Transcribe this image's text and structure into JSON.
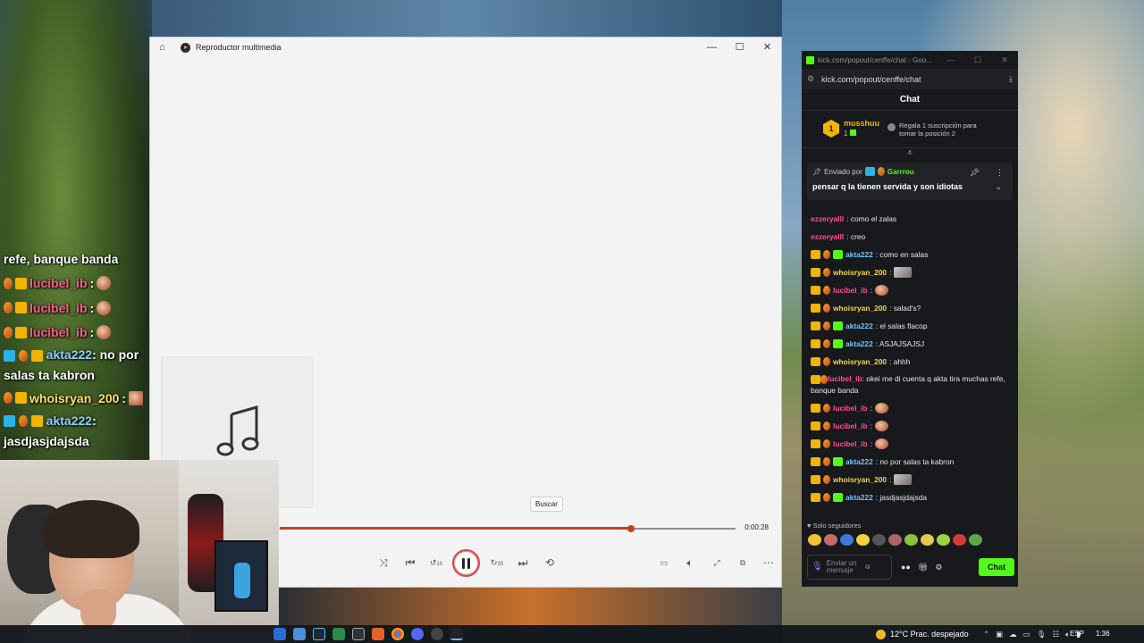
{
  "player": {
    "title": "Reproductor multimedia",
    "home_icon": "home-icon",
    "tooltip": "Buscar",
    "elapsed": "0:00:28",
    "progress_fraction": 0.77,
    "controls": [
      "shuffle-icon",
      "previous-icon",
      "rewind-10-icon",
      "pause-icon",
      "forward-30-icon",
      "next-icon",
      "repeat-icon"
    ],
    "rewind_label": "10",
    "forward_label": "30"
  },
  "overlay_chat": {
    "lines": [
      {
        "text": "refe, banque banda"
      },
      {
        "name": "lucibel_ib",
        "sep": ":"
      },
      {
        "name": "lucibel_ib",
        "sep": ":"
      },
      {
        "name": "lucibel_ib",
        "sep": ":"
      },
      {
        "name": "akta222",
        "msg": ": no por salas ta kabron"
      },
      {
        "name": "whoisryan_200",
        "sep": ":"
      },
      {
        "name": "akta222",
        "msg": ": jasdjasjdajsda"
      }
    ]
  },
  "kick": {
    "window_title": "kick.com/popout/cenffe/chat - Goo...",
    "url": "kick.com/popout/cenffe/chat",
    "header": "Chat",
    "leader": {
      "rank": "1",
      "name": "musshuu",
      "count": "1",
      "gift_text": "Regala 1 suscripción para tomar la posición 2"
    },
    "pinned": {
      "by_label": "Enviado por",
      "by_name": "Garrrou",
      "text": "pensar q la tienen servida y son idiotas"
    },
    "messages": [
      {
        "name": "ezzeryalll",
        "text": ": como el zalas",
        "color": "pink",
        "badges": false
      },
      {
        "name": "ezzeryalll",
        "text": ": creo",
        "color": "pink",
        "badges": false
      },
      {
        "name": "akta222",
        "text": ": como en salas",
        "color": "blue",
        "badges": true,
        "sub": true
      },
      {
        "name": "whoisryan_200",
        "text": ":",
        "color": "gold",
        "badges": true,
        "emote": true
      },
      {
        "name": "lucibel_ib",
        "text": ":",
        "color": "pink",
        "badges": true,
        "emote": true
      },
      {
        "name": "whoisryan_200",
        "text": ": salad's?",
        "color": "gold",
        "badges": true
      },
      {
        "name": "akta222",
        "text": ": el salas flacop",
        "color": "blue",
        "badges": true,
        "sub": true
      },
      {
        "name": "akta222",
        "text": ": ASJAJSAJSJ",
        "color": "blue",
        "badges": true,
        "sub": true
      },
      {
        "name": "whoisryan_200",
        "text": ": ahhh",
        "color": "gold",
        "badges": true
      },
      {
        "name": "lucibel_ib",
        "text": ": okei me di cuenta q akta tira muchas refe, banque banda",
        "color": "pink",
        "badges": true,
        "multi": true
      },
      {
        "name": "lucibel_ib",
        "text": ":",
        "color": "pink",
        "badges": true,
        "emote": true
      },
      {
        "name": "lucibel_ib",
        "text": ":",
        "color": "pink",
        "badges": true,
        "emote": true
      },
      {
        "name": "lucibel_ib",
        "text": ":",
        "color": "pink",
        "badges": true,
        "emote": true
      },
      {
        "name": "akta222",
        "text": ": no por salas ta kabron",
        "color": "blue",
        "badges": true,
        "sub": true
      },
      {
        "name": "whoisryan_200",
        "text": ":",
        "color": "gold",
        "badges": true,
        "emote": true
      },
      {
        "name": "akta222",
        "text": ": jasdjasjdajsda",
        "color": "blue",
        "badges": true,
        "sub": true
      }
    ],
    "followers_only": "Solo seguidores",
    "input_placeholder": "Enviar un mensaje",
    "chat_button": "Chat"
  },
  "taskbar": {
    "weather": "12°C  Prac. despejado",
    "lang": "ESP",
    "time": "1:36"
  },
  "colors": {
    "kick_green": "#53fc18",
    "seek_red": "#c2401f"
  }
}
